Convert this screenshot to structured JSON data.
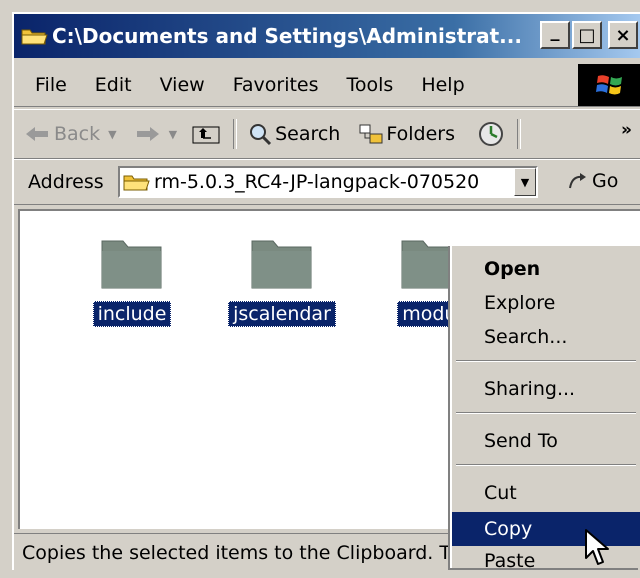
{
  "window": {
    "title": "C:\\Documents and Settings\\Administrat...",
    "controls": {
      "minimize": "_",
      "maximize": "□",
      "close": "×"
    }
  },
  "menubar": {
    "items": [
      "File",
      "Edit",
      "View",
      "Favorites",
      "Tools",
      "Help"
    ]
  },
  "toolbar": {
    "back": "Back",
    "search": "Search",
    "folders": "Folders",
    "more": "»"
  },
  "addressbar": {
    "label": "Address",
    "value": "rm-5.0.3_RC4-JP-langpack-070520",
    "go": "Go"
  },
  "folders": [
    {
      "name": "include",
      "selected": true
    },
    {
      "name": "jscalendar",
      "selected": true
    },
    {
      "name": "modul",
      "selected": true
    }
  ],
  "statusbar": {
    "text": "Copies the selected items to the Clipboard. T"
  },
  "context_menu": {
    "items": [
      {
        "label": "Open",
        "bold": true
      },
      {
        "label": "Explore"
      },
      {
        "label": "Search..."
      },
      {
        "label": "Sharing..."
      },
      {
        "label": "Send To"
      },
      {
        "label": "Cut"
      },
      {
        "label": "Copy",
        "highlighted": true
      },
      {
        "label": "Paste"
      }
    ]
  },
  "colors": {
    "titlebar": "#0a246a",
    "selection": "#0a246a",
    "face": "#d4d0c8"
  },
  "icons": [
    "folder-icon",
    "back-arrow-icon",
    "forward-arrow-icon",
    "up-folder-icon",
    "search-icon",
    "folders-icon",
    "history-icon",
    "go-arrow-icon",
    "windows-logo-icon",
    "mouse-cursor-icon"
  ]
}
